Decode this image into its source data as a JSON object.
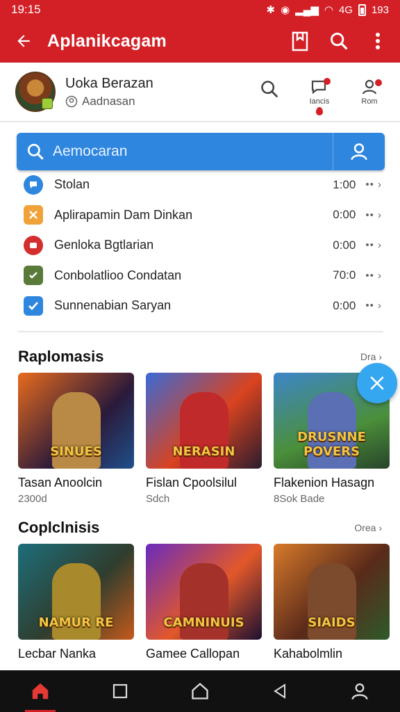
{
  "status_bar": {
    "time": "19:15",
    "network": "4G",
    "battery": "193"
  },
  "app_bar": {
    "title": "Aplanikcagam"
  },
  "profile": {
    "name": "Uoka Berazan",
    "subtitle": "Aadnasan",
    "action1_label": "Iancis",
    "action2_label": "Rom"
  },
  "search": {
    "placeholder": "Aemocaran"
  },
  "list": [
    {
      "label": "Stolan",
      "time": "1:00",
      "icon": "chat-icon",
      "color": "#2e86de"
    },
    {
      "label": "Aplirapamin Dam Dinkan",
      "time": "0:00",
      "icon": "tools-icon",
      "color": "#f0a23a"
    },
    {
      "label": "Genloka Bgtlarian",
      "time": "0:00",
      "icon": "stop-icon",
      "color": "#d32f2f"
    },
    {
      "label": "Conbolatlioo Condatan",
      "time": "70:0",
      "icon": "check-icon",
      "color": "#5a7a3a"
    },
    {
      "label": "Sunnenabian Saryan",
      "time": "0:00",
      "icon": "checkbox-icon",
      "color": "#2e86de"
    }
  ],
  "section1": {
    "title": "Raplomasis",
    "more": "Dra",
    "cards": [
      {
        "title": "Tasan Anoolcin",
        "sub": "2300d",
        "logo": "SINUES"
      },
      {
        "title": "Fislan Cpoolsilul",
        "sub": "Sdch",
        "logo": "NERASIN"
      },
      {
        "title": "Flakenion Hasagn",
        "sub": "8Sok Bade",
        "logo": "DRUSNNE POVERS"
      }
    ]
  },
  "section2": {
    "title": "Coplclnisis",
    "more": "Orea",
    "cards": [
      {
        "title": "Lecbar Nanka",
        "logo": "NAMUR RE"
      },
      {
        "title": "Gamee Callopan",
        "logo": "CAMNINUIS"
      },
      {
        "title": "Kahabolmlin",
        "logo": "SIAIDS"
      }
    ]
  },
  "colors": {
    "brand": "#d32027",
    "accent": "#2e86de",
    "fab": "#35a7f0"
  }
}
